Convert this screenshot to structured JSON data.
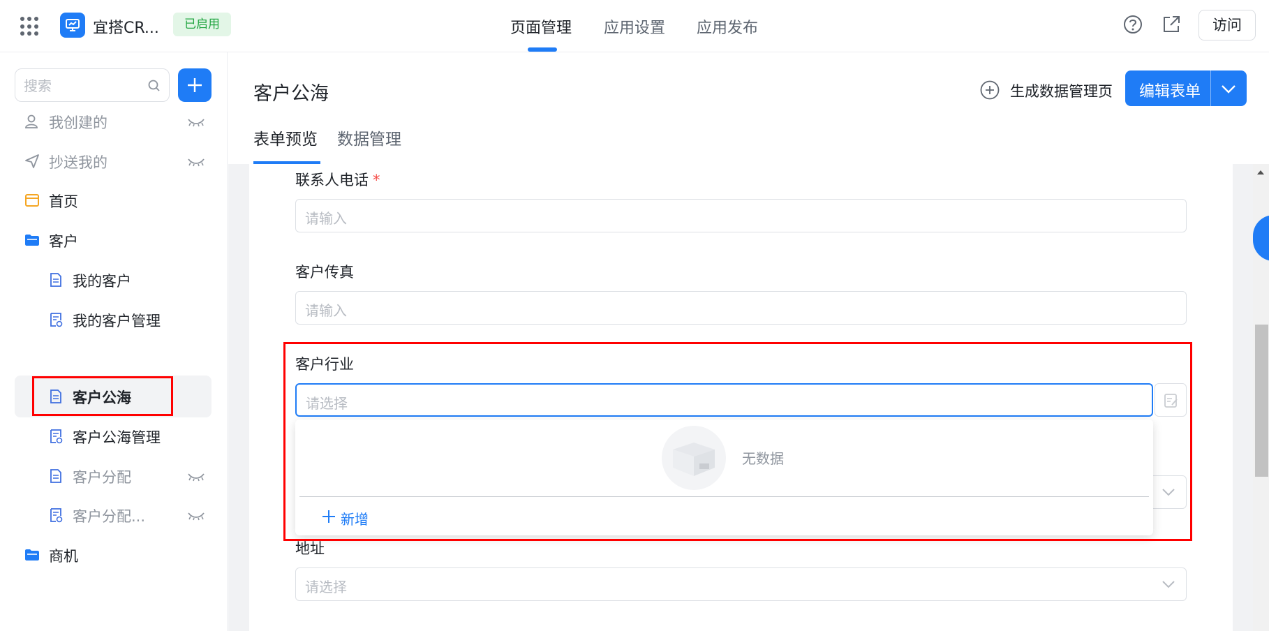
{
  "header": {
    "app_name": "宜搭CR...",
    "status": "已启用",
    "tabs": [
      "页面管理",
      "应用设置",
      "应用发布"
    ],
    "active_tab": "页面管理",
    "visit_label": "访问",
    "accent_color": "#1f7cf6"
  },
  "sidebar": {
    "search_placeholder": "搜索",
    "items": [
      {
        "label": "我创建的",
        "icon": "user-icon",
        "hidden": true
      },
      {
        "label": "抄送我的",
        "icon": "send-icon",
        "hidden": true
      },
      {
        "label": "首页",
        "icon": "home-page-icon"
      },
      {
        "label": "客户",
        "icon": "folder-icon"
      },
      {
        "label": "我的客户",
        "icon": "form-icon"
      },
      {
        "label": "我的客户管理",
        "icon": "form-manage-icon"
      },
      {
        "label": "客户公海",
        "icon": "form-icon",
        "selected": true
      },
      {
        "label": "客户公海管理",
        "icon": "form-manage-icon"
      },
      {
        "label": "客户分配",
        "icon": "form-icon",
        "hidden": true
      },
      {
        "label": "客户分配...",
        "icon": "form-manage-icon",
        "hidden": true
      },
      {
        "label": "商机",
        "icon": "folder-icon"
      }
    ]
  },
  "main": {
    "page_title": "客户公海",
    "generate_label": "生成数据管理页",
    "edit_form_label": "编辑表单",
    "sub_tabs": [
      "表单预览",
      "数据管理"
    ],
    "fields": [
      {
        "label": "联系人电话",
        "required_mark": "*",
        "placeholder": "请输入"
      },
      {
        "label": "客户传真",
        "placeholder": "请输入"
      },
      {
        "label": "客户行业",
        "placeholder": "请选择"
      },
      {
        "label": "地址",
        "placeholder": "请选择"
      }
    ],
    "dropdown": {
      "empty_text": "无数据",
      "add_label": "新增"
    }
  }
}
